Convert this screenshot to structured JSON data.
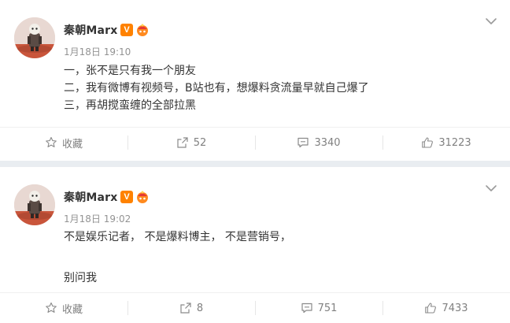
{
  "posts": [
    {
      "username": "秦朝Marx",
      "verified_badge": "V",
      "timestamp": "1月18日 19:10",
      "content_lines": [
        "一，张不是只有我一个朋友",
        "二，我有微博有视频号，B站也有，想爆料贪流量早就自己爆了",
        "三，再胡搅蛮缠的全部拉黑"
      ],
      "actions": {
        "favorite_label": "收藏",
        "repost_count": "52",
        "comment_count": "3340",
        "like_count": "31223"
      }
    },
    {
      "username": "秦朝Marx",
      "verified_badge": "V",
      "timestamp": "1月18日 19:02",
      "content_lines": [
        "不是娱乐记者， 不是爆料博主， 不是营销号，",
        "",
        "别问我"
      ],
      "actions": {
        "favorite_label": "收藏",
        "repost_count": "8",
        "comment_count": "751",
        "like_count": "7433"
      }
    }
  ],
  "icons": [
    "avatar",
    "verified-v-icon",
    "vip-hat-icon",
    "chevron-down-icon",
    "star-icon",
    "repost-icon",
    "comment-icon",
    "thumbs-up-icon"
  ],
  "colors": {
    "text_primary": "#333333",
    "text_secondary": "#939393",
    "action_text": "#808080",
    "verified_orange": "#ff8200",
    "separator": "#e9edf1"
  }
}
